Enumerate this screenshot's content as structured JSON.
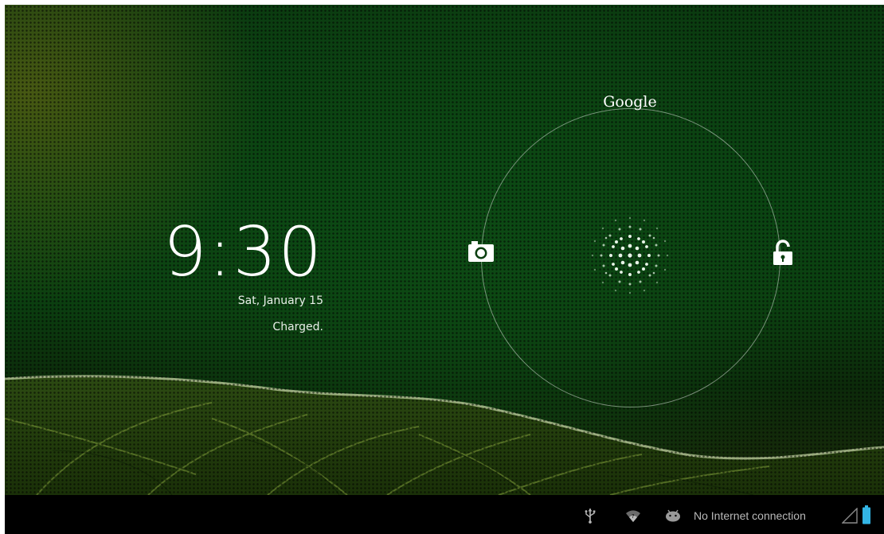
{
  "lockscreen": {
    "time": "9:30",
    "date": "Sat, January 15",
    "status": "Charged."
  },
  "unlock_ring": {
    "top_target_label": "Google",
    "left_target_icon": "camera-icon",
    "right_target_icon": "unlock-icon"
  },
  "status_bar": {
    "connection_text": "No Internet connection",
    "icons": [
      "usb-icon",
      "wifi-icon",
      "android-debug-icon",
      "signal-icon",
      "battery-icon"
    ]
  },
  "colors": {
    "wallpaper_green": "#0b3f10",
    "bar_bg": "#000000",
    "battery_blue": "#33b5e5",
    "status_text": "#b9b9b9"
  }
}
